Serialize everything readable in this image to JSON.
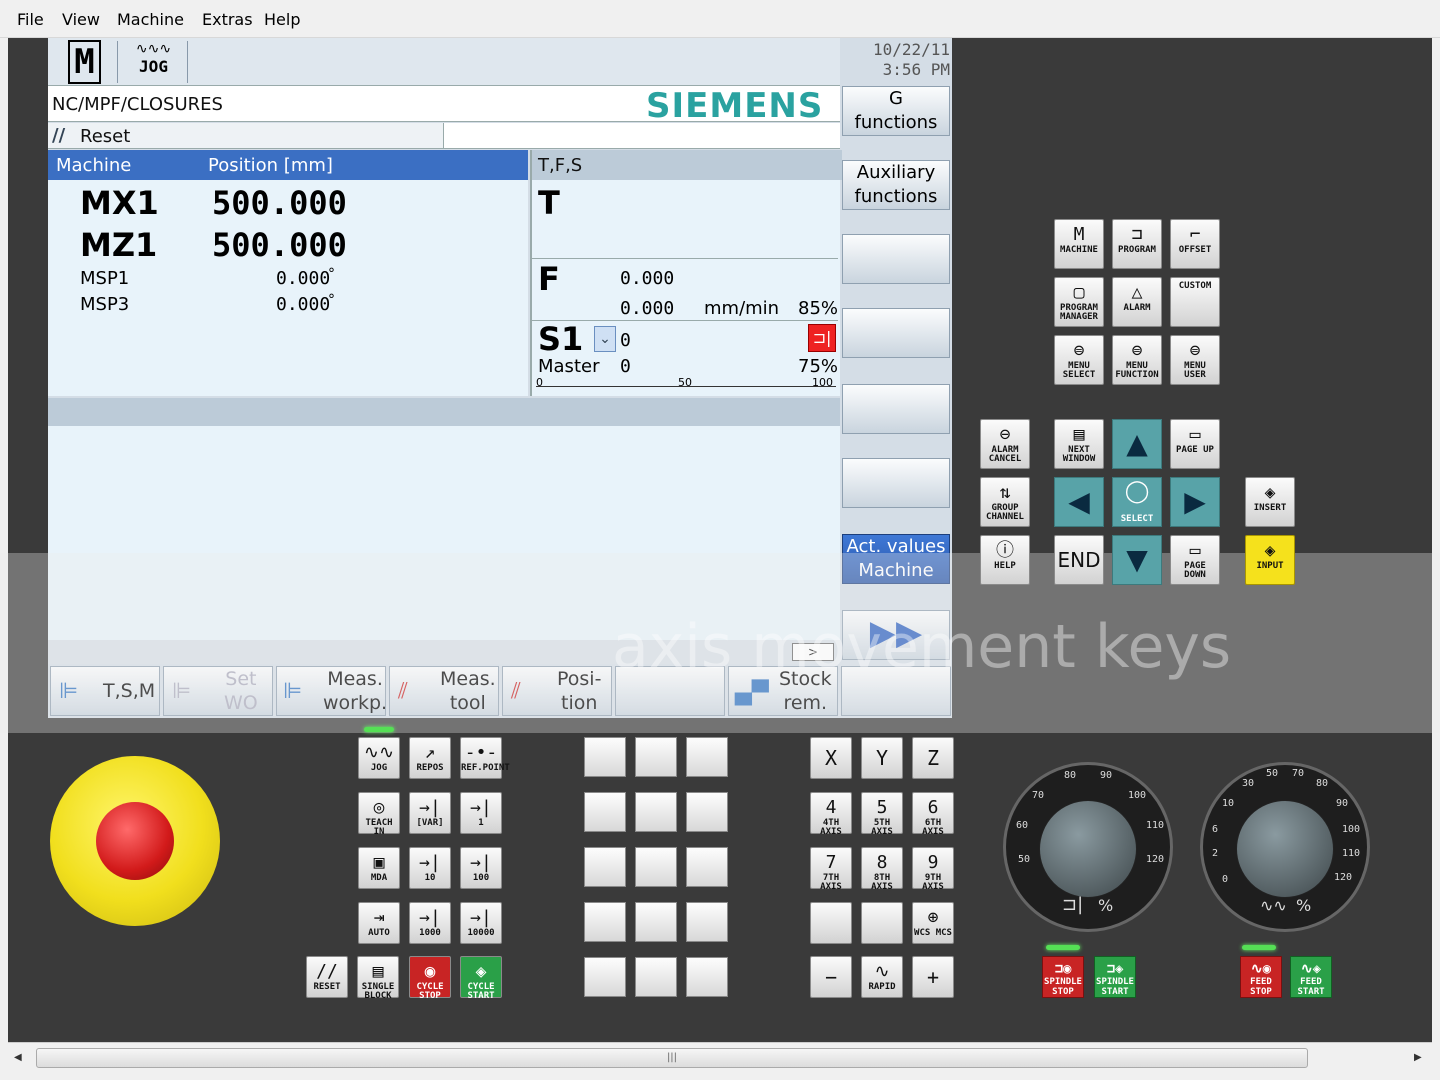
{
  "menu": [
    "File",
    "View",
    "Machine",
    "Extras",
    "Help"
  ],
  "header": {
    "logo": "M",
    "mode": "JOG",
    "date": "10/22/11",
    "time": "3:56 PM",
    "path": "NC/MPF/CLOSURES",
    "brand": "SIEMENS",
    "status": "Reset"
  },
  "position": {
    "col1": "Machine",
    "col2": "Position [mm]",
    "rows": [
      {
        "axis": "MX1",
        "value": "500.000",
        "unit": ""
      },
      {
        "axis": "MZ1",
        "value": "500.000",
        "unit": ""
      },
      {
        "axis": "MSP1",
        "value": "0.000",
        "unit": "°"
      },
      {
        "axis": "MSP3",
        "value": "0.000",
        "unit": "°"
      }
    ]
  },
  "tfs": {
    "title": "T,F,S",
    "t": "T",
    "f": "F",
    "f_val1": "0.000",
    "f_val2": "0.000",
    "f_unit": "mm/min",
    "f_pct": "85%",
    "s": "S1",
    "s_val": "0",
    "master": "Master",
    "master_val": "0",
    "master_pct": "75%",
    "scale": [
      "0",
      "50",
      "100"
    ]
  },
  "vsoftkeys": [
    {
      "l1": "G",
      "l2": "functions"
    },
    {
      "l1": "Auxiliary",
      "l2": "functions"
    },
    {
      "l1": "",
      "l2": ""
    },
    {
      "l1": "",
      "l2": ""
    },
    {
      "l1": "",
      "l2": ""
    },
    {
      "l1": "",
      "l2": ""
    },
    {
      "l1": "Act. values",
      "l2": "Machine"
    }
  ],
  "hsoftkeys": [
    {
      "l1": "T,S,M",
      "l2": ""
    },
    {
      "l1": "Set",
      "l2": "WO"
    },
    {
      "l1": "Meas.",
      "l2": "workp."
    },
    {
      "l1": "Meas.",
      "l2": "tool"
    },
    {
      "l1": "Posi-",
      "l2": "tion"
    },
    {
      "l1": "",
      "l2": ""
    },
    {
      "l1": "Stock",
      "l2": "rem."
    },
    {
      "l1": "",
      "l2": ""
    }
  ],
  "overlay": "axis movement keys",
  "modekeys": [
    {
      "sym": "∿∿",
      "lbl": "JOG"
    },
    {
      "sym": "↗",
      "lbl": "REPOS"
    },
    {
      "sym": "-•-",
      "lbl": "REF.POINT"
    },
    {
      "sym": "◎",
      "lbl": "TEACH IN"
    },
    {
      "sym": "→|",
      "lbl": "[VAR]"
    },
    {
      "sym": "→|",
      "lbl": "1"
    },
    {
      "sym": "▣",
      "lbl": "MDA"
    },
    {
      "sym": "→|",
      "lbl": "10"
    },
    {
      "sym": "→|",
      "lbl": "100"
    },
    {
      "sym": "⇥",
      "lbl": "AUTO"
    },
    {
      "sym": "→|",
      "lbl": "1000"
    },
    {
      "sym": "→|",
      "lbl": "10000"
    }
  ],
  "bottomkeys": [
    {
      "sym": "//",
      "lbl": "RESET"
    },
    {
      "sym": "▤",
      "lbl": "SINGLE BLOCK"
    },
    {
      "sym": "◉",
      "lbl": "CYCLE STOP"
    },
    {
      "sym": "◈",
      "lbl": "CYCLE START"
    }
  ],
  "axiskeys": [
    {
      "sym": "X",
      "lbl": ""
    },
    {
      "sym": "Y",
      "lbl": ""
    },
    {
      "sym": "Z",
      "lbl": ""
    },
    {
      "sym": "4",
      "lbl": "4TH AXIS"
    },
    {
      "sym": "5",
      "lbl": "5TH AXIS"
    },
    {
      "sym": "6",
      "lbl": "6TH AXIS"
    },
    {
      "sym": "7",
      "lbl": "7TH AXIS"
    },
    {
      "sym": "8",
      "lbl": "8TH AXIS"
    },
    {
      "sym": "9",
      "lbl": "9TH AXIS"
    },
    {
      "sym": "",
      "lbl": ""
    },
    {
      "sym": "",
      "lbl": ""
    },
    {
      "sym": "⊕",
      "lbl": "WCS MCS"
    },
    {
      "sym": "−",
      "lbl": ""
    },
    {
      "sym": "∿",
      "lbl": "RAPID"
    },
    {
      "sym": "+",
      "lbl": ""
    }
  ],
  "opkeys": [
    {
      "sym": "M",
      "lbl": "MACHINE"
    },
    {
      "sym": "⊐",
      "lbl": "PROGRAM"
    },
    {
      "sym": "⌐",
      "lbl": "OFFSET"
    },
    {
      "sym": "▢",
      "lbl": "PROGRAM MANAGER"
    },
    {
      "sym": "△",
      "lbl": "ALARM"
    },
    {
      "sym": "",
      "lbl": "CUSTOM"
    },
    {
      "sym": "⊜",
      "lbl": "MENU SELECT"
    },
    {
      "sym": "⊜",
      "lbl": "MENU FUNCTION"
    },
    {
      "sym": "⊜",
      "lbl": "MENU USER"
    }
  ],
  "navkeys": {
    "alarm_cancel": "ALARM CANCEL",
    "next_window": "NEXT WINDOW",
    "page_up": "PAGE UP",
    "group_channel": "GROUP CHANNEL",
    "select": "SELECT",
    "insert": "INSERT",
    "help": "HELP",
    "end": "END",
    "page_down": "PAGE DOWN",
    "input": "INPUT"
  },
  "dial1": {
    "ticks": [
      "50",
      "60",
      "70",
      "80",
      "90",
      "100",
      "110",
      "120"
    ],
    "label": "%"
  },
  "dial2": {
    "ticks": [
      "0",
      "2",
      "6",
      "10",
      "30",
      "50",
      "70",
      "80",
      "90",
      "100",
      "110",
      "120"
    ],
    "label": "%"
  },
  "spindle": [
    {
      "lbl": "SPINDLE STOP"
    },
    {
      "lbl": "SPINDLE START"
    }
  ],
  "feed": [
    {
      "lbl": "FEED STOP"
    },
    {
      "lbl": "FEED START"
    }
  ],
  "colors": {
    "siemens": "#2aa2a0",
    "header": "#3b6fc3",
    "estop": "#f1df1d",
    "input": "#f5e11c"
  }
}
